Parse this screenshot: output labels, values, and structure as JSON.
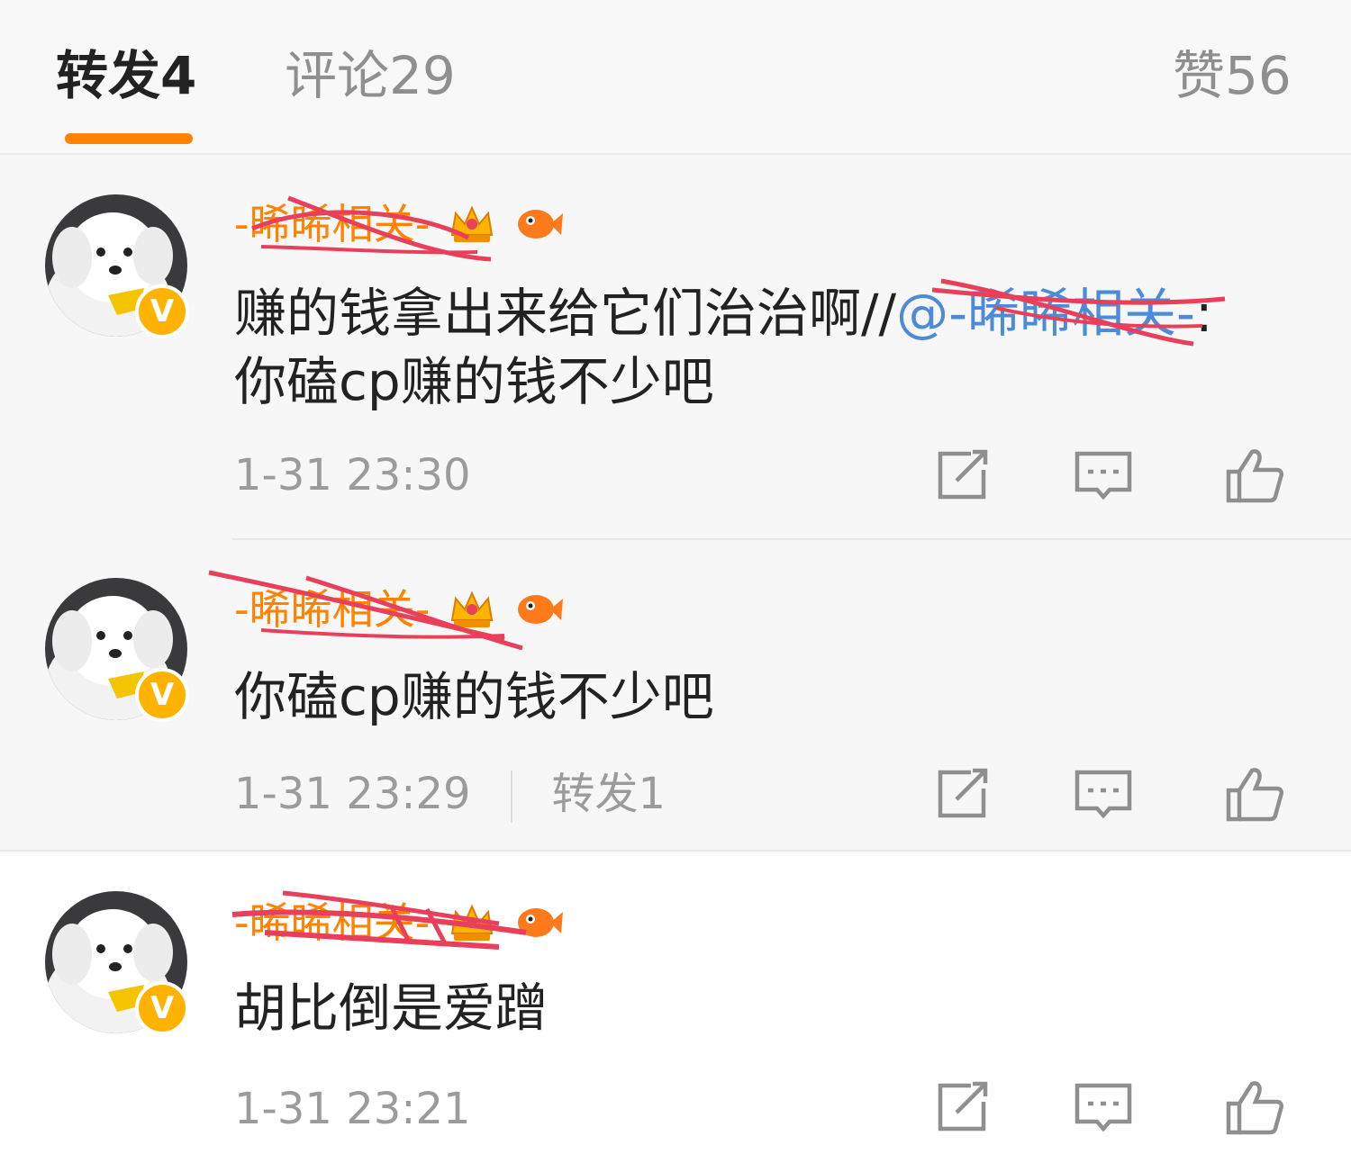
{
  "tabs": [
    {
      "label": "转发",
      "count": "4",
      "active": true
    },
    {
      "label": "评论",
      "count": "29",
      "active": false
    },
    {
      "label": "赞",
      "count": "56",
      "active": false
    }
  ],
  "items": [
    {
      "username": "-晞晞相关-",
      "content_text": "赚的钱拿出来给它们治治啊//",
      "mention": "@-晞晞相关-",
      "content_tail": ":",
      "content_line2": "你磕cp赚的钱不少吧",
      "time": "1-31 23:30"
    },
    {
      "username": "-晞晞相关-",
      "content_text": "你磕cp赚的钱不少吧",
      "time": "1-31 23:29",
      "repost": "转发1"
    },
    {
      "username": "-晞晞相关-",
      "content_text": "胡比倒是爱蹭",
      "time": "1-31 23:21"
    }
  ],
  "badges": {
    "verified": "V",
    "icons": [
      "crown-icon",
      "fish-icon"
    ]
  },
  "colors": {
    "accent": "#ff8200",
    "username": "#ff8200",
    "mention": "#4c8bd8",
    "scribble": "#e8405a",
    "verified": "#ffb300"
  }
}
